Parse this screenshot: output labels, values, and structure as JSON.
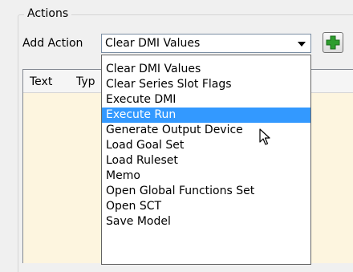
{
  "group": {
    "title": "Actions"
  },
  "add_action": {
    "label": "Add Action",
    "selected_value": "Clear DMI Values"
  },
  "table": {
    "columns": [
      "Text",
      "Typ"
    ]
  },
  "dropdown": {
    "options": [
      "Clear DMI Values",
      "Clear Series Slot Flags",
      "Execute DMI",
      "Execute Run",
      "Generate Output Device",
      "Load Goal Set",
      "Load Ruleset",
      "Memo",
      "Open Global Functions Set",
      "Open SCT",
      "Save Model"
    ],
    "highlighted_option": "Execute Run"
  },
  "colors": {
    "highlight": "#3399ff",
    "table_background": "#fdf5df",
    "add_icon": "#2e9d2e"
  },
  "icons": {
    "add_button": "plus-icon",
    "combo_arrow": "chevron-down-icon",
    "cursor": "pointer-cursor-icon"
  }
}
